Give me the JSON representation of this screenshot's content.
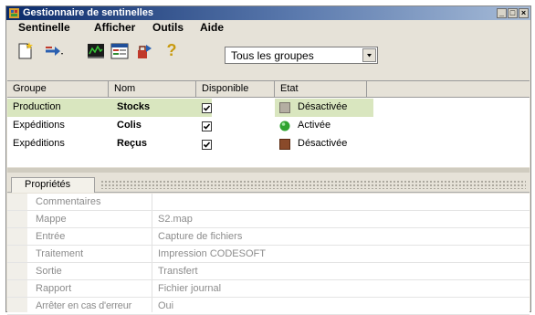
{
  "window": {
    "title": "Gestionnaire de sentinelles",
    "minimize_glyph": "_",
    "maximize_glyph": "□",
    "close_glyph": "×"
  },
  "menu": [
    "Sentinelle",
    "Afficher",
    "Outils",
    "Aide"
  ],
  "toolbar": {
    "icons": [
      "new-sentinel-icon",
      "arrow-dropdown-icon",
      "monitor-icon",
      "properties-icon",
      "test-icon",
      "help-icon"
    ],
    "help_glyph": "?",
    "group_filter": "Tous les groupes"
  },
  "table": {
    "columns": [
      "Groupe",
      "Nom",
      "Disponible",
      "Etat"
    ],
    "rows": [
      {
        "group": "Production",
        "name": "Stocks",
        "available": true,
        "status": "Désactivée",
        "status_color": "#b4aea2"
      },
      {
        "group": "Expéditions",
        "name": "Colis",
        "available": true,
        "status": "Activée",
        "status_color": "#2fa32f"
      },
      {
        "group": "Expéditions",
        "name": "Reçus",
        "available": true,
        "status": "Désactivée",
        "status_color": "#8a4a2a"
      }
    ]
  },
  "properties": {
    "tab_label": "Propriétés",
    "rows": [
      {
        "name": "Commentaires",
        "value": ""
      },
      {
        "name": "Mappe",
        "value": "S2.map"
      },
      {
        "name": "Entrée",
        "value": "Capture de fichiers"
      },
      {
        "name": "Traitement",
        "value": "Impression CODESOFT"
      },
      {
        "name": "Sortie",
        "value": "Transfert"
      },
      {
        "name": "Rapport",
        "value": "Fichier journal"
      },
      {
        "name": "Arrêter en cas d'erreur",
        "value": "Oui"
      }
    ]
  },
  "colors": {
    "selected_row": "#d9e6bf",
    "title_gradient_start": "#0a2a6a",
    "activated": "#2fa32f"
  }
}
